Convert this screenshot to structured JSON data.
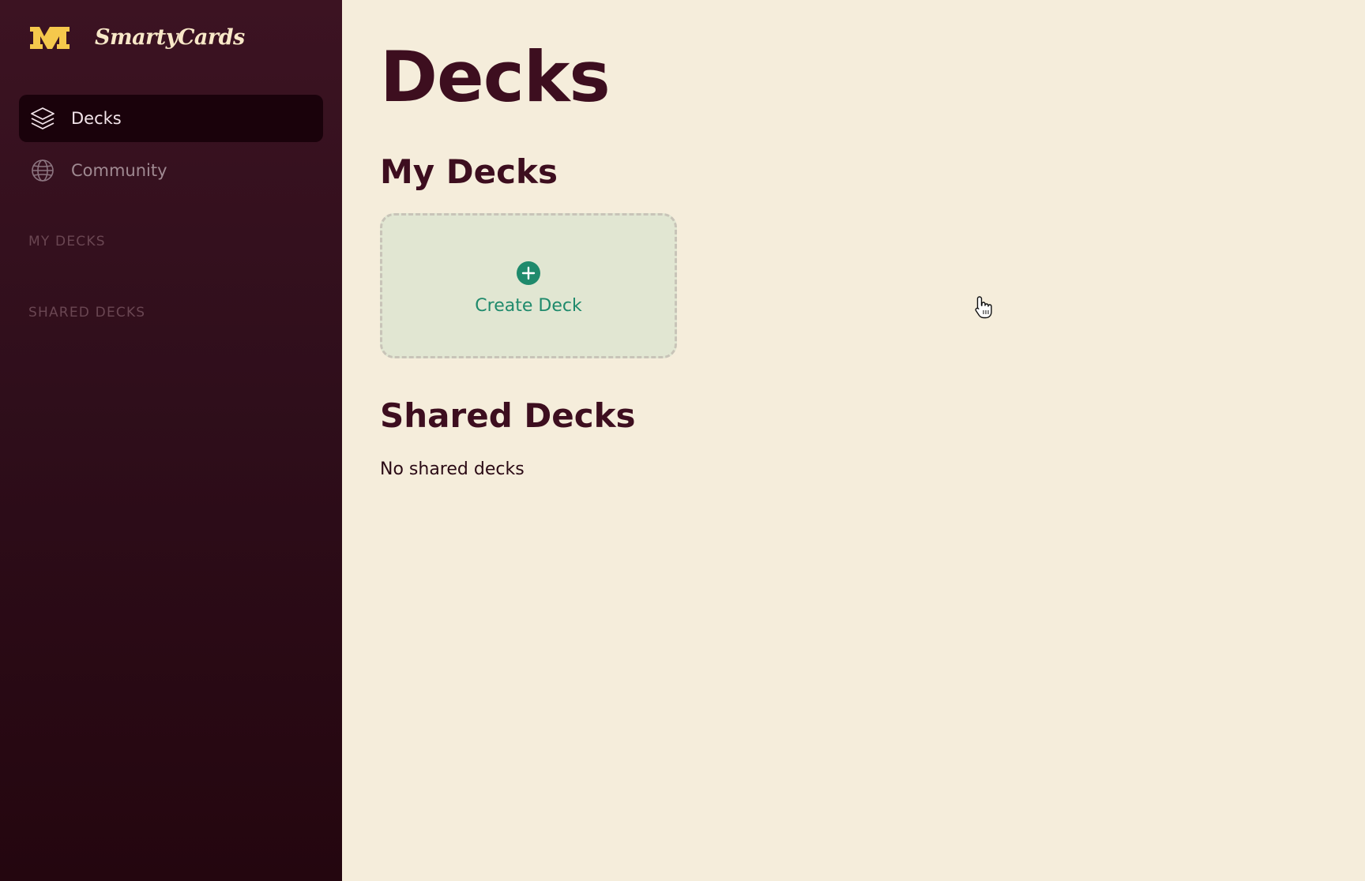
{
  "sidebar": {
    "brand": {
      "logo_icon": "maroon-m-logo",
      "name": "SmartyCards"
    },
    "nav_items": [
      {
        "label": "Decks",
        "icon": "stacked-layers-icon",
        "active": true
      },
      {
        "label": "Community",
        "icon": "globe-icon",
        "active": false
      }
    ],
    "sections": {
      "my_decks": "MY DECKS",
      "shared_decks": "SHARED DECKS"
    }
  },
  "main": {
    "title": "Decks",
    "my_decks": {
      "heading": "My Decks",
      "create_label": "Create Deck"
    },
    "shared_decks": {
      "heading": "Shared Decks",
      "empty_text": "No shared decks"
    }
  },
  "colors": {
    "sidebar_bg": "#2f0e1b",
    "main_bg": "#f5eddb",
    "heading": "#3d0e1f",
    "accent_green": "#1f8a6c",
    "brand_gold": "#f5c84c"
  }
}
